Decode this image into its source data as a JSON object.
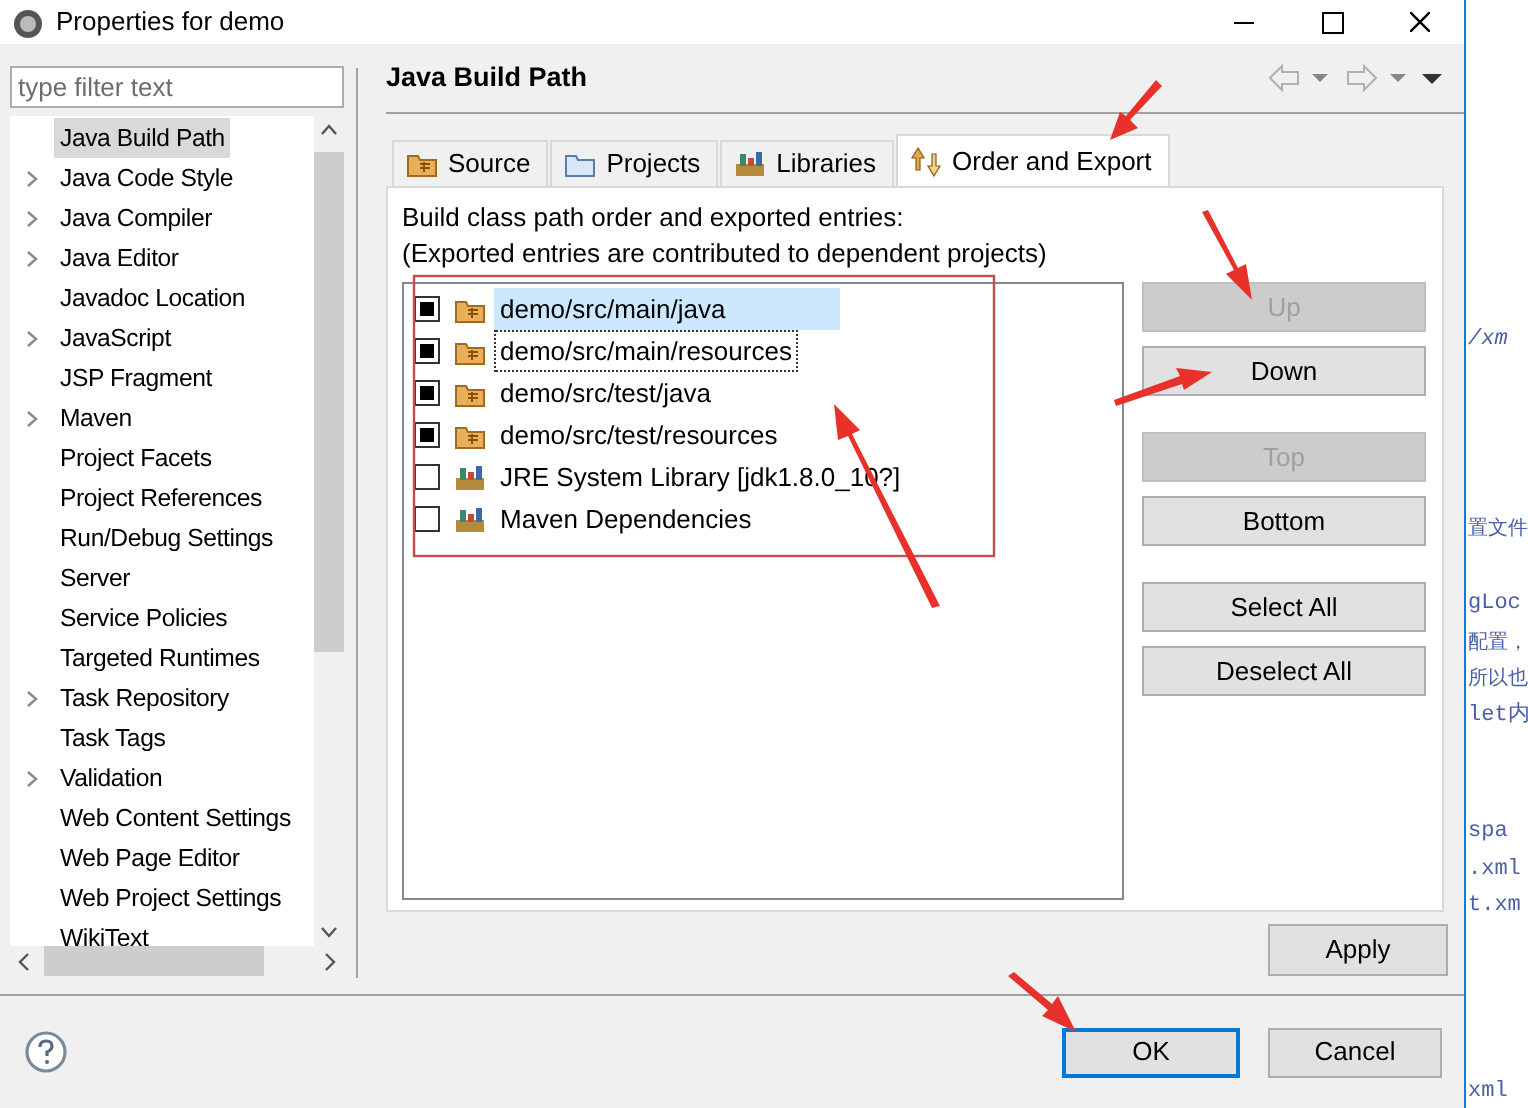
{
  "window": {
    "title": "Properties for demo"
  },
  "filter": {
    "placeholder": "type filter text"
  },
  "tree": [
    {
      "label": "Java Build Path",
      "expandable": false,
      "selected": true
    },
    {
      "label": "Java Code Style",
      "expandable": true,
      "selected": false
    },
    {
      "label": "Java Compiler",
      "expandable": true,
      "selected": false
    },
    {
      "label": "Java Editor",
      "expandable": true,
      "selected": false
    },
    {
      "label": "Javadoc Location",
      "expandable": false,
      "selected": false
    },
    {
      "label": "JavaScript",
      "expandable": true,
      "selected": false
    },
    {
      "label": "JSP Fragment",
      "expandable": false,
      "selected": false
    },
    {
      "label": "Maven",
      "expandable": true,
      "selected": false
    },
    {
      "label": "Project Facets",
      "expandable": false,
      "selected": false
    },
    {
      "label": "Project References",
      "expandable": false,
      "selected": false
    },
    {
      "label": "Run/Debug Settings",
      "expandable": false,
      "selected": false
    },
    {
      "label": "Server",
      "expandable": false,
      "selected": false
    },
    {
      "label": "Service Policies",
      "expandable": false,
      "selected": false
    },
    {
      "label": "Targeted Runtimes",
      "expandable": false,
      "selected": false
    },
    {
      "label": "Task Repository",
      "expandable": true,
      "selected": false
    },
    {
      "label": "Task Tags",
      "expandable": false,
      "selected": false
    },
    {
      "label": "Validation",
      "expandable": true,
      "selected": false
    },
    {
      "label": "Web Content Settings",
      "expandable": false,
      "selected": false
    },
    {
      "label": "Web Page Editor",
      "expandable": false,
      "selected": false
    },
    {
      "label": "Web Project Settings",
      "expandable": false,
      "selected": false
    },
    {
      "label": "WikiText",
      "expandable": false,
      "selected": false
    }
  ],
  "page": {
    "title": "Java Build Path"
  },
  "tabs": [
    {
      "label": "Source",
      "kind": "source",
      "selected": false
    },
    {
      "label": "Projects",
      "kind": "projects",
      "selected": false
    },
    {
      "label": "Libraries",
      "kind": "libraries",
      "selected": false
    },
    {
      "label": "Order and Export",
      "kind": "order",
      "selected": true
    }
  ],
  "description": [
    "Build class path order and exported entries:",
    "(Exported entries are contributed to dependent projects)"
  ],
  "entries": [
    {
      "label": "demo/src/main/java",
      "kind": "folder",
      "checked": true,
      "selected": true,
      "focused": false
    },
    {
      "label": "demo/src/main/resources",
      "kind": "folder",
      "checked": true,
      "selected": false,
      "focused": true
    },
    {
      "label": "demo/src/test/java",
      "kind": "folder",
      "checked": true,
      "selected": false,
      "focused": false
    },
    {
      "label": "demo/src/test/resources",
      "kind": "folder",
      "checked": true,
      "selected": false,
      "focused": false
    },
    {
      "label": "JRE System Library [jdk1.8.0_10?]",
      "kind": "library",
      "checked": false,
      "selected": false,
      "focused": false
    },
    {
      "label": "Maven Dependencies",
      "kind": "library",
      "checked": false,
      "selected": false,
      "focused": false
    }
  ],
  "side_buttons": [
    [
      {
        "label": "Up",
        "disabled": true
      },
      {
        "label": "Down",
        "disabled": false
      }
    ],
    [
      {
        "label": "Top",
        "disabled": true
      },
      {
        "label": "Bottom",
        "disabled": false
      }
    ],
    [
      {
        "label": "Select All",
        "disabled": false
      },
      {
        "label": "Deselect All",
        "disabled": false
      }
    ]
  ],
  "apply": "Apply",
  "ok": "OK",
  "cancel": "Cancel",
  "editor_fragments": [
    {
      "text": "/xm",
      "kind": "italic"
    },
    {
      "text": "置文件",
      "kind": "plain"
    },
    {
      "text": "gLoc",
      "kind": "mono"
    },
    {
      "text": "配置，",
      "kind": "plain"
    },
    {
      "text": "所以也",
      "kind": "plain"
    },
    {
      "text": "let内",
      "kind": "mono"
    },
    {
      "text": "spa",
      "kind": "mono"
    },
    {
      "text": ".xml",
      "kind": "mono"
    },
    {
      "text": "t.xm",
      "kind": "mono"
    },
    {
      "text": "xml",
      "kind": "mono"
    }
  ]
}
